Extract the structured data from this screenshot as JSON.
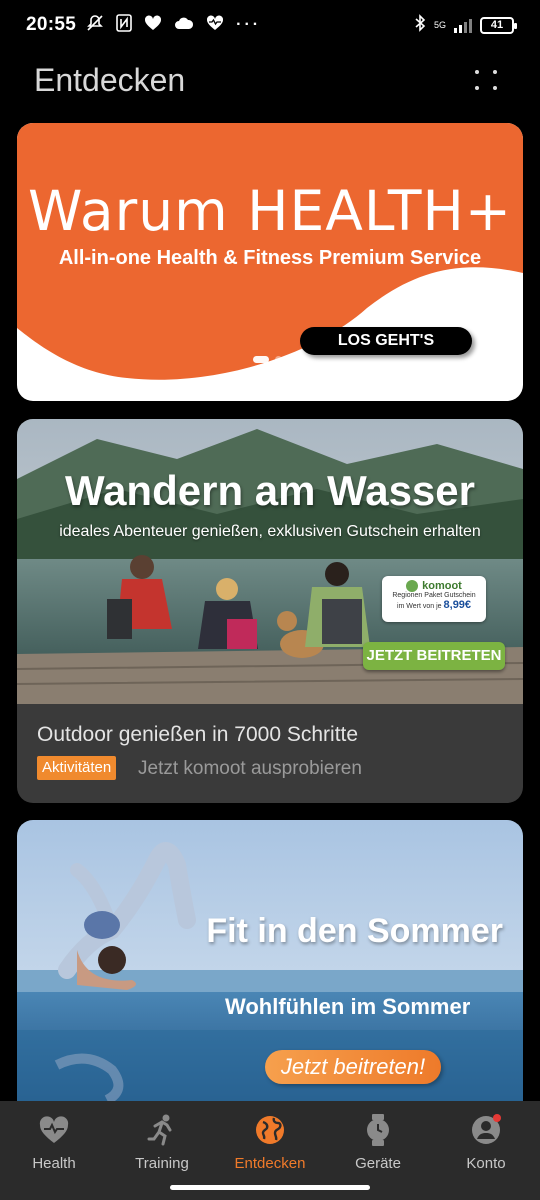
{
  "status_bar": {
    "time": "20:55",
    "network": "5G",
    "battery": "41"
  },
  "header": {
    "title": "Entdecken"
  },
  "cards": [
    {
      "title": "Warum HEALTH+",
      "subtitle": "All-in-one Health & Fitness Premium Service",
      "button": "LOS GEHT'S"
    },
    {
      "banner_title": "Wandern am Wasser",
      "banner_subtitle": "ideales Abenteuer genießen, exklusiven Gutschein erhalten",
      "coupon_brand": "komoot",
      "coupon_line1": "Regionen Paket Gutschein",
      "coupon_line2": "im Wert von je",
      "coupon_price": "8,99€",
      "join_button": "JETZT BEITRETEN",
      "heading": "Outdoor genießen in 7000 Schritte",
      "tag": "Aktivitäten",
      "description": "Jetzt komoot ausprobieren"
    },
    {
      "title": "Fit in den Sommer",
      "subtitle": "Wohlfühlen im Sommer",
      "button": "Jetzt beitreten!"
    }
  ],
  "nav": {
    "items": [
      {
        "label": "Health",
        "icon": "heart-icon"
      },
      {
        "label": "Training",
        "icon": "runner-icon"
      },
      {
        "label": "Entdecken",
        "icon": "globe-icon"
      },
      {
        "label": "Geräte",
        "icon": "watch-icon"
      },
      {
        "label": "Konto",
        "icon": "account-icon"
      }
    ]
  },
  "colors": {
    "accent": "#f07a2a",
    "background": "#000000",
    "card_bg": "#3a3a3a",
    "nav_bg": "#2b2b2b"
  }
}
